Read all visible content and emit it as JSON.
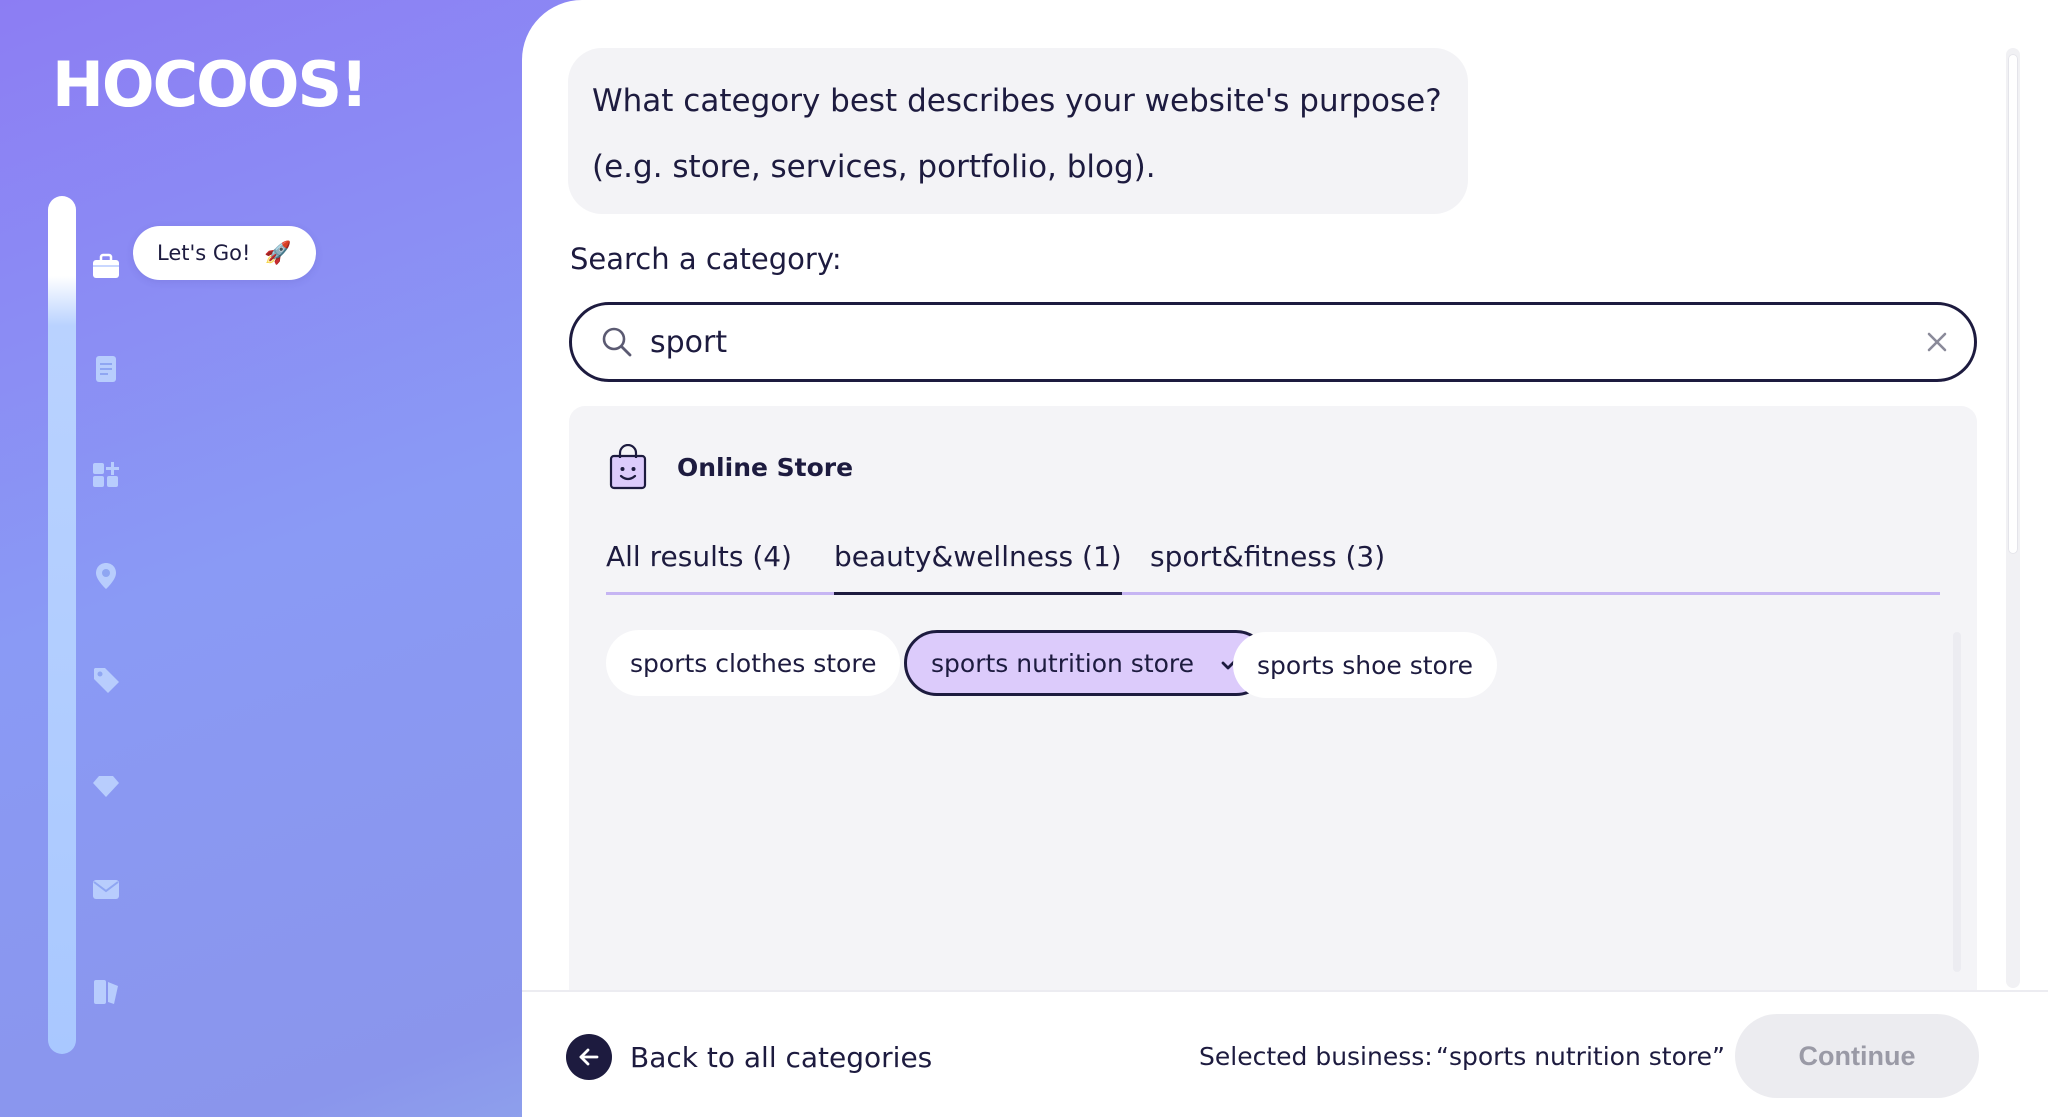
{
  "brand": {
    "logo_text": "HOCOOS!"
  },
  "sidebar": {
    "bubble_label": "Let's Go!",
    "bubble_icon": "rocket-icon",
    "items": [
      {
        "icon": "briefcase-icon"
      },
      {
        "icon": "document-icon"
      },
      {
        "icon": "add-widget-icon"
      },
      {
        "icon": "location-pin-icon"
      },
      {
        "icon": "tag-icon"
      },
      {
        "icon": "diamond-icon"
      },
      {
        "icon": "mail-icon"
      },
      {
        "icon": "brand-book-icon"
      }
    ]
  },
  "question": {
    "line1": "What category best describes your website's purpose?",
    "line2": "(e.g. store, services, portfolio, blog)."
  },
  "search": {
    "label": "Search a category:",
    "value": "sport"
  },
  "results": {
    "group_title": "Online Store",
    "tabs": [
      {
        "label": "All results (4)"
      },
      {
        "label": "beauty&wellness (1)"
      },
      {
        "label": "sport&fitness (3)"
      }
    ],
    "active_tab": "beauty&wellness (1)",
    "chips": [
      {
        "label": "sports clothes store",
        "selected": false
      },
      {
        "label": "sports nutrition store",
        "selected": true
      },
      {
        "label": "sports shoe store",
        "selected": false
      }
    ]
  },
  "footer": {
    "back_label": "Back to all categories",
    "selected_label": "Selected business:",
    "selected_value": "“sports nutrition store”",
    "continue_label": "Continue"
  },
  "colors": {
    "accent_dark": "#1d1b3f",
    "chip_selected": "#dccbfb",
    "tab_underline": "#c6b5f3",
    "sidebar_gradient_start": "#8c7df3",
    "sidebar_gradient_end": "#a6e0ea"
  }
}
